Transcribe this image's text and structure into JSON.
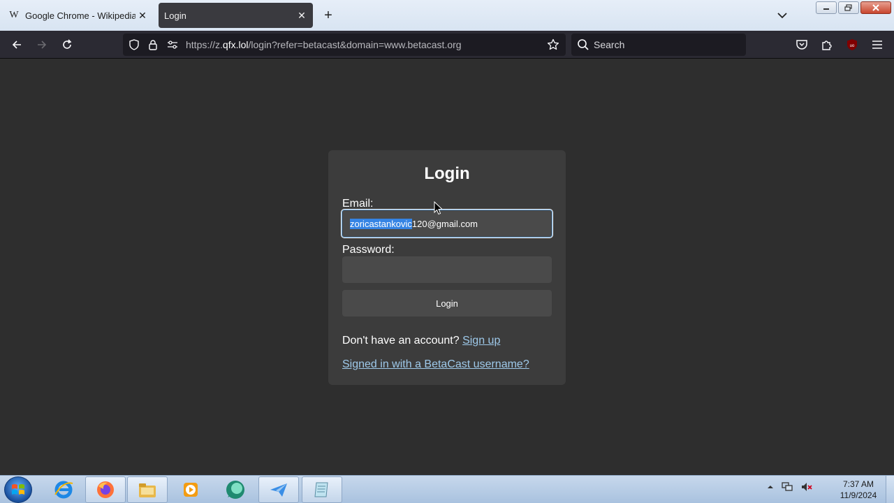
{
  "browser": {
    "tabs": [
      {
        "title": "Google Chrome - Wikipedia",
        "favicon": "W",
        "active": false
      },
      {
        "title": "Login",
        "active": true
      }
    ],
    "url": {
      "prefix": "https://z.",
      "domain": "qfx.lol",
      "suffix": "/login?refer=betacast&domain=www.betacast.org"
    },
    "search_placeholder": "Search"
  },
  "page": {
    "heading": "Login",
    "email_label": "Email:",
    "email_value_selected": "zoricastankovic",
    "email_value_rest": "120@gmail.com",
    "password_label": "Password:",
    "login_button": "Login",
    "no_account_text": "Don't have an account?",
    "signup_link": "Sign up",
    "alt_link": "Signed in with a BetaCast username?"
  },
  "taskbar": {
    "time": "7:37 AM",
    "date": "11/9/2024"
  },
  "colors": {
    "page_bg": "#2e2e2e",
    "card_bg": "#3c3c3c",
    "link": "#9ec9ea",
    "selection": "#3584e4"
  }
}
